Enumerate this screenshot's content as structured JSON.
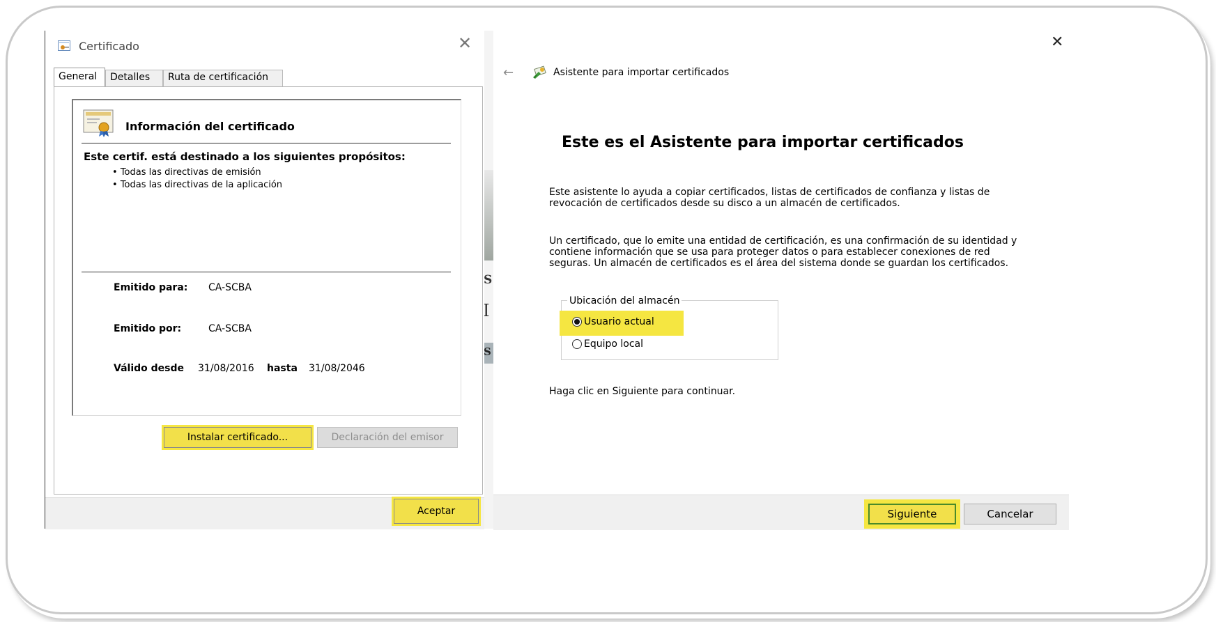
{
  "certificate_dialog": {
    "title": "Certificado",
    "tabs": [
      "General",
      "Detalles",
      "Ruta de certificación"
    ],
    "info_heading": "Información del certificado",
    "purpose_title": "Este certif. está destinado a los siguientes propósitos:",
    "purposes": [
      "• Todas las directivas de emisión",
      "• Todas las directivas de la aplicación"
    ],
    "issued_to_label": "Emitido para:",
    "issued_to_value": "CA-SCBA",
    "issued_by_label": "Emitido por:",
    "issued_by_value": "CA-SCBA",
    "valid_from_label": "Válido desde",
    "valid_from_value": "31/08/2016",
    "valid_to_label": "hasta",
    "valid_to_value": "31/08/2046",
    "install_button": "Instalar certificado...",
    "issuer_statement_button": "Declaración del emisor",
    "accept_button": "Aceptar"
  },
  "background_fragments": [
    "S",
    "I",
    "S"
  ],
  "wizard": {
    "title": "Asistente para importar certificados",
    "heading": "Este es el Asistente para importar certificados",
    "paragraph1": "Este asistente lo ayuda a copiar certificados, listas de certificados de confianza y listas de revocación de certificados desde su disco a un almacén de certificados.",
    "paragraph2": "Un certificado, que lo emite una entidad de certificación, es una confirmación de su identidad y contiene información que se usa para proteger datos o para establecer conexiones de red seguras. Un almacén de certificados es el área del sistema donde se guardan los certificados.",
    "store_location_label": "Ubicación del almacén",
    "options": [
      {
        "label": "Usuario actual",
        "selected": true
      },
      {
        "label": "Equipo local",
        "selected": false
      }
    ],
    "continue_text": "Haga clic en Siguiente para continuar.",
    "next_button": "Siguiente",
    "cancel_button": "Cancelar"
  },
  "colors": {
    "highlight": "#f5e641",
    "next_border": "#4a8a2a"
  },
  "icons": [
    "certificate-icon",
    "close-icon",
    "back-arrow-icon",
    "certificate-wizard-icon"
  ]
}
